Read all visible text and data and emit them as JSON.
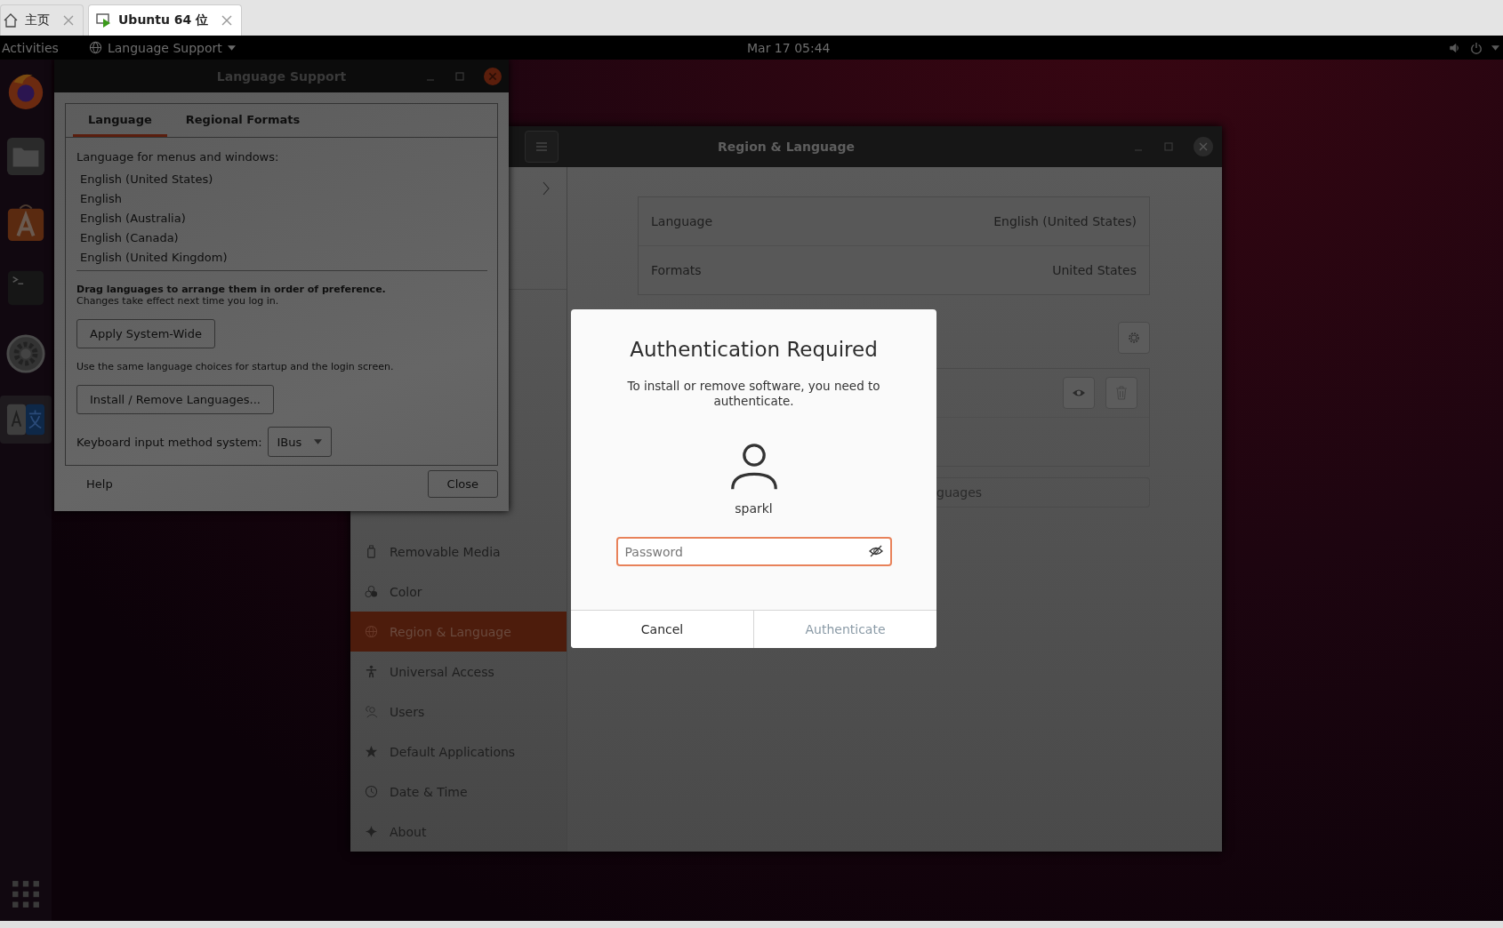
{
  "vm_tabs": [
    {
      "label": "主页",
      "selected": false
    },
    {
      "label": "Ubuntu 64 位",
      "selected": true
    }
  ],
  "top_bar": {
    "activities": "Activities",
    "app_menu": "Language Support",
    "clock": "Mar 17  05:44"
  },
  "dock": [
    {
      "kind": "firefox",
      "selected": false
    },
    {
      "kind": "files",
      "selected": false
    },
    {
      "kind": "software",
      "selected": false
    },
    {
      "kind": "terminal",
      "selected": false
    },
    {
      "kind": "settings",
      "selected": false
    },
    {
      "kind": "language",
      "selected": true
    }
  ],
  "language_support": {
    "title": "Language Support",
    "tabs": [
      {
        "label": "Language",
        "selected": true
      },
      {
        "label": "Regional Formats",
        "selected": false
      }
    ],
    "list_label": "Language for menus and windows:",
    "languages": [
      "English (United States)",
      "English",
      "English (Australia)",
      "English (Canada)",
      "English (United Kingdom)"
    ],
    "hint_bold": "Drag languages to arrange them in order of preference.",
    "hint": "Changes take effect next time you log in.",
    "apply_button": "Apply System-Wide",
    "apply_hint": "Use the same language choices for startup and the login screen.",
    "install_button": "Install / Remove Languages...",
    "input_label": "Keyboard input method system:",
    "input_value": "IBus",
    "help": "Help",
    "close": "Close"
  },
  "region_window": {
    "title": "Region & Language",
    "sidebar": [
      {
        "label": "Removable Media",
        "kind": "media",
        "selected": false
      },
      {
        "label": "Color",
        "kind": "color",
        "selected": false
      },
      {
        "label": "Region & Language",
        "kind": "globe",
        "selected": true
      },
      {
        "label": "Universal Access",
        "kind": "access",
        "selected": false
      },
      {
        "label": "Users",
        "kind": "users",
        "selected": false
      },
      {
        "label": "Default Applications",
        "kind": "star",
        "selected": false
      },
      {
        "label": "Date & Time",
        "kind": "clock",
        "selected": false
      },
      {
        "label": "About",
        "kind": "about",
        "selected": false
      }
    ],
    "settings": [
      {
        "label": "Language",
        "value": "English (United States)"
      },
      {
        "label": "Formats",
        "value": "United States"
      }
    ],
    "manage_button": "guages"
  },
  "auth_dialog": {
    "title": "Authentication Required",
    "message": "To install or remove software, you need to authenticate.",
    "user": "sparkl",
    "password": {
      "placeholder": "Password"
    },
    "buttons": [
      {
        "label": "Cancel",
        "disabled": false
      },
      {
        "label": "Authenticate",
        "disabled": true
      }
    ]
  }
}
